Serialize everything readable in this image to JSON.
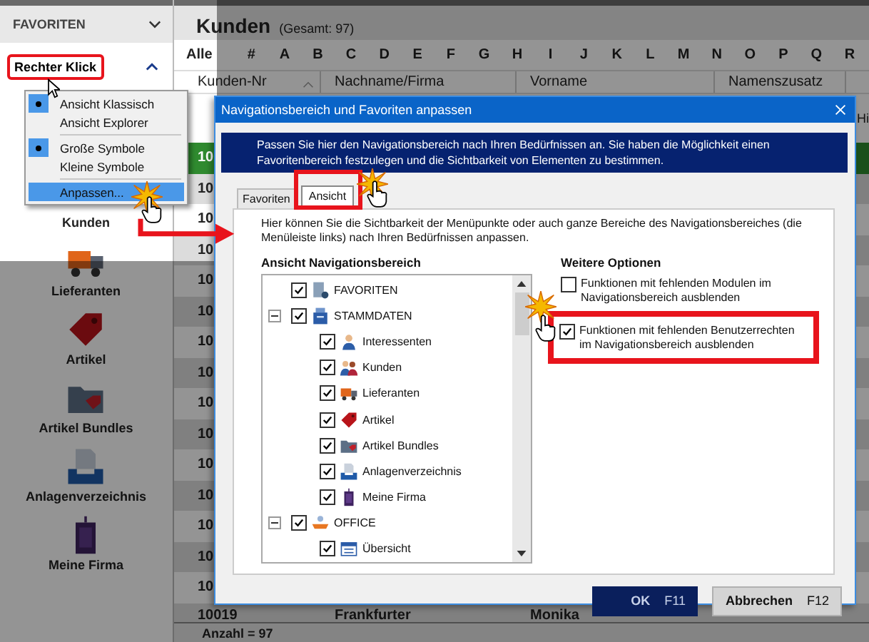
{
  "sidebar": {
    "header": "FAVORITEN",
    "items": [
      {
        "label": "Kunden"
      },
      {
        "label": "Lieferanten"
      },
      {
        "label": "Artikel"
      },
      {
        "label": "Artikel Bundles"
      },
      {
        "label": "Anlagenverzeichnis"
      },
      {
        "label": "Meine Firma"
      }
    ]
  },
  "callout": "Rechter Klick",
  "context_menu": [
    {
      "kind": "option",
      "label": "Ansicht Klassisch",
      "selected": true
    },
    {
      "kind": "option",
      "label": "Ansicht Explorer",
      "selected": false
    },
    {
      "kind": "separator"
    },
    {
      "kind": "option",
      "label": "Große Symbole",
      "selected": true
    },
    {
      "kind": "option",
      "label": "Kleine Symbole",
      "selected": false
    },
    {
      "kind": "separator"
    },
    {
      "kind": "command",
      "label": "Anpassen...",
      "highlighted": true
    }
  ],
  "grid": {
    "title": "Kunden",
    "total": "(Gesamt: 97)",
    "letters": [
      "Alle",
      "#",
      "A",
      "B",
      "C",
      "D",
      "E",
      "F",
      "G",
      "H",
      "I",
      "J",
      "K",
      "L",
      "M",
      "N",
      "O",
      "P",
      "Q",
      "R"
    ],
    "columns": [
      "Kunden-Nr",
      "Nachname/Firma",
      "Vorname",
      "Namenszusatz"
    ],
    "column_5": "Hi",
    "rows": [
      {
        "cells": [
          "10"
        ],
        "selected": true
      },
      {
        "cells": [
          "10"
        ],
        "selected": false
      },
      {
        "cells": [
          "10"
        ],
        "selected": false
      },
      {
        "cells": [
          "10"
        ],
        "selected": false
      },
      {
        "cells": [
          "10"
        ],
        "selected": false
      },
      {
        "cells": [
          "10"
        ],
        "selected": false
      },
      {
        "cells": [
          "10"
        ],
        "selected": false
      },
      {
        "cells": [
          "10"
        ],
        "selected": false
      },
      {
        "cells": [
          "10"
        ],
        "selected": false
      },
      {
        "cells": [
          "10"
        ],
        "selected": false
      },
      {
        "cells": [
          "10"
        ],
        "selected": false
      },
      {
        "cells": [
          "10"
        ],
        "selected": false
      },
      {
        "cells": [
          "10"
        ],
        "selected": false
      },
      {
        "cells": [
          "10"
        ],
        "selected": false
      },
      {
        "cells": [
          "10"
        ],
        "selected": false
      },
      {
        "cells": [
          "10019",
          "Frankfurter",
          "Monika"
        ],
        "selected": false
      }
    ],
    "status": "Anzahl = 97"
  },
  "dialog": {
    "title": "Navigationsbereich und Favoriten anpassen",
    "info": "Passen Sie hier den Navigationsbereich nach Ihren Bedürfnissen an. Sie haben die Möglichkeit einen Favoritenbereich festzulegen und die Sichtbarkeit von Elementen zu bestimmen.",
    "tabs": [
      {
        "label": "Favoriten",
        "selected": false
      },
      {
        "label": "Ansicht",
        "selected": true
      }
    ],
    "description": "Hier können Sie die Sichtbarkeit der Menüpunkte oder auch ganze Bereiche des Navigationsbereiches (die Menüleiste links) nach Ihren Bedürfnissen anpassen.",
    "tree_heading": "Ansicht Navigationsbereich",
    "tree": [
      {
        "label": "FAVORITEN",
        "checked": true
      },
      {
        "label": "STAMMDATEN",
        "checked": true,
        "expanded": true,
        "children": [
          {
            "label": "Interessenten",
            "checked": true
          },
          {
            "label": "Kunden",
            "checked": true
          },
          {
            "label": "Lieferanten",
            "checked": true
          },
          {
            "label": "Artikel",
            "checked": true
          },
          {
            "label": "Artikel Bundles",
            "checked": true
          },
          {
            "label": "Anlagenverzeichnis",
            "checked": true
          },
          {
            "label": "Meine Firma",
            "checked": true
          }
        ]
      },
      {
        "label": "OFFICE",
        "checked": true,
        "expanded": true,
        "children": [
          {
            "label": "Übersicht",
            "checked": true
          }
        ]
      }
    ],
    "options_heading": "Weitere Optionen",
    "options": [
      {
        "label": "Funktionen mit fehlenden Modulen im Navigationsbereich ausblenden",
        "checked": false,
        "highlighted": false
      },
      {
        "label": "Funktionen mit fehlenden Benutzerrechten im Navigationsbereich ausblenden",
        "checked": true,
        "highlighted": true
      }
    ],
    "buttons": [
      {
        "label": "OK",
        "shortcut": "F11",
        "kind": "primary"
      },
      {
        "label": "Abbrechen",
        "shortcut": "F12",
        "kind": "secondary"
      }
    ]
  }
}
